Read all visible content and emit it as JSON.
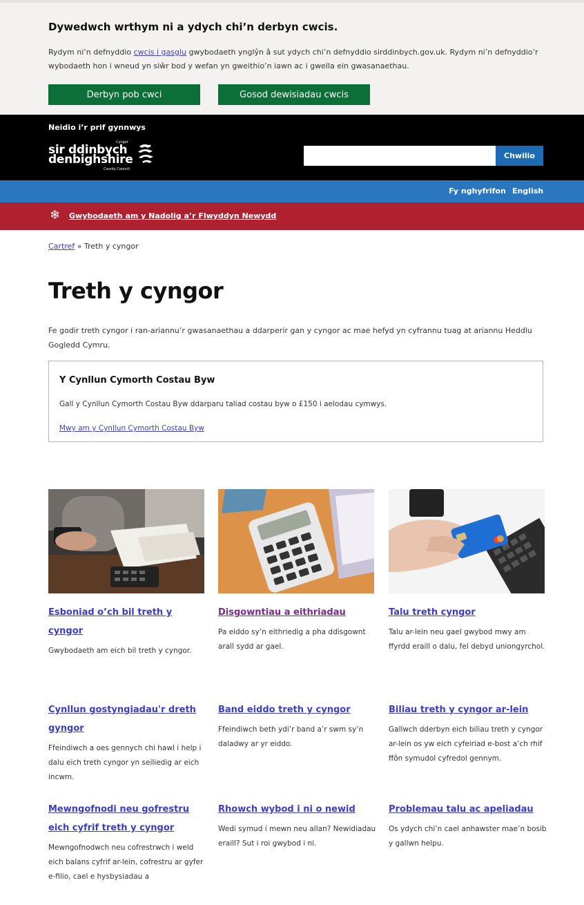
{
  "cookie_banner": {
    "heading": "Dywedwch wrthym ni a ydych chi’n derbyn cwcis.",
    "text_before": "Rydym ni’n defnyddio ",
    "link": "cwcis i gasglu",
    "text_after": " gwybodaeth ynglŷn â sut ydych chi’n defnyddio sirddinbych.gov.uk. Rydym ni’n defnyddio’r wybodaeth hon i wneud yn siŵr bod y wefan yn gweithio’n iawn ac i gwella ein gwasanaethau.",
    "accept_label": "Derbyn pob cwci",
    "settings_label": "Gosod dewisiadau cwcis"
  },
  "header": {
    "skip_link": "Neidio i’r prif gynnwys",
    "logo_line1": "sir ddinbych",
    "logo_line2": "denbighshire",
    "logo_small_top": "Cyngor",
    "logo_small_bottom": "County Council",
    "search_placeholder": "",
    "search_button": "Chwilio"
  },
  "nav": {
    "my_account": "Fy nghyfrifon",
    "language": "English"
  },
  "notice": {
    "icon": "snowflake-icon",
    "link": "Gwybodaeth am y Nadolig a’r Flwyddyn Newydd"
  },
  "breadcrumb": {
    "home": "Cartref",
    "separator": "»",
    "current": "Treth y cyngor"
  },
  "page": {
    "title": "Treth y cyngor",
    "intro": "Fe godir treth cyngor i ran-ariannu’r gwasanaethau a ddarperir gan y cyngor ac mae hefyd yn cyfrannu tuag at ariannu Heddlu Gogledd Cymru."
  },
  "callout": {
    "title": "Y Cynllun Cymorth Costau Byw",
    "text": "Gall y Cynllun Cymorth Costau Byw ddarparu taliad costau byw o £150 i aelodau cymwys.",
    "link": "Mwy am y Cynllun Cymorth Costau Byw"
  },
  "cards": [
    {
      "title": "Esboniad o’ch bil treth y cyngor",
      "desc": "Gwybodaeth am eich bil treth y cyngor."
    },
    {
      "title": "Disgowntiau a eithriadau",
      "desc": "Pa eiddo sy’n eithriedig a pha ddisgownt arall sydd ar gael."
    },
    {
      "title": "Talu treth cyngor",
      "desc": "Talu ar-lein neu gael gwybod mwy am ffyrdd eraill o dalu, fel debyd uniongyrchol."
    },
    {
      "title": "Cynllun gostyngiadau'r dreth gyngor",
      "desc": "Ffeindiwch a oes gennych chi hawl i help i dalu eich treth cyngor yn seiliedig ar eich incwm."
    },
    {
      "title": "Band eiddo treth y cyngor",
      "desc": "Ffeindiwch beth ydi’r band a’r swm sy’n daladwy ar yr eiddo."
    },
    {
      "title": "Biliau treth y cyngor ar-lein",
      "desc": "Gallwch dderbyn eich biliau treth y cyngor ar-lein os yw eich cyfeiriad e-bost a’ch rhif ffôn symudol cyfredol gennym."
    },
    {
      "title": "Mewngofnodi neu gofrestru eich cyfrif treth y cyngor",
      "desc": "Mewngofnodwch neu cofrestrwch i weld eich balans cyfrif ar-lein, cofrestru ar gyfer e-filio, cael e hysbysiadau a"
    },
    {
      "title": "Rhowch wybod i ni o newid",
      "desc": "Wedi symud i mewn neu allan? Newidiadau eraill? Sut i roi gwybod i ni."
    },
    {
      "title": "Problemau talu ac apeliadau",
      "desc": "Os ydych chi’n cael anhawster mae’n bosib y gallwn helpu."
    }
  ],
  "colors": {
    "cookie_button": "#0b7038",
    "header_bg": "#000000",
    "nav_bg": "#2a77c0",
    "notice_bg": "#b0212f",
    "link": "#3d3dc2",
    "visited_link": "#7a2a8e"
  }
}
